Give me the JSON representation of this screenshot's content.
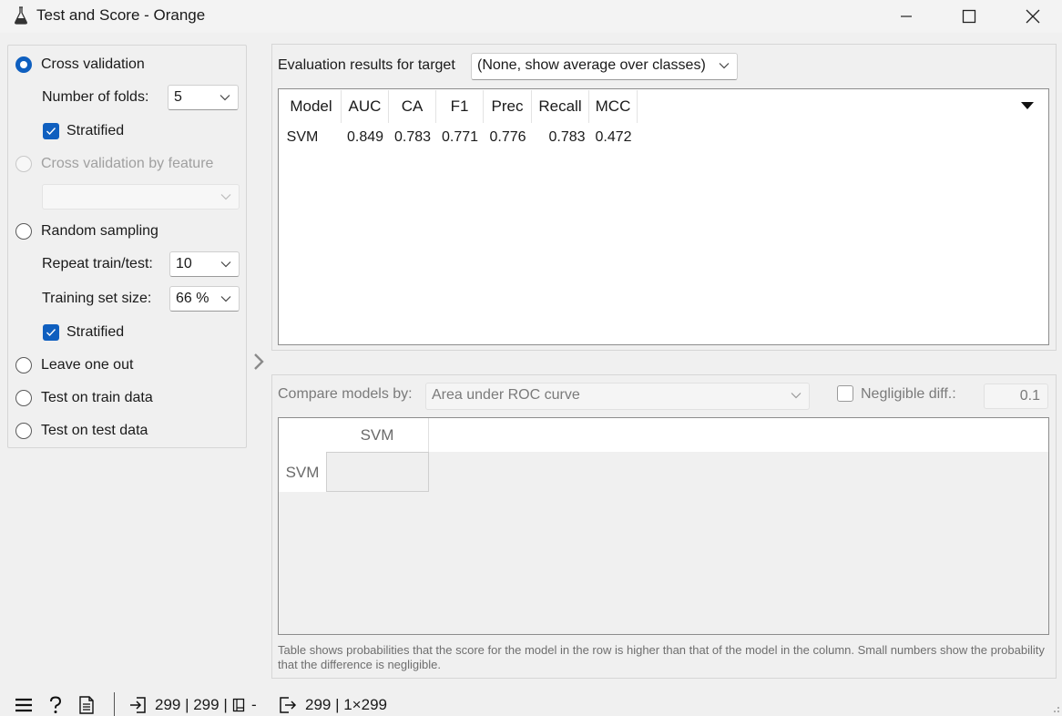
{
  "window": {
    "title": "Test and Score - Orange",
    "controls": [
      "minimize-icon",
      "maximize-icon",
      "close-icon"
    ]
  },
  "sampling": {
    "cross_validation": {
      "label": "Cross validation",
      "selected": true
    },
    "folds": {
      "label": "Number of folds:",
      "value": "5"
    },
    "stratified_cv": {
      "label": "Stratified",
      "checked": true
    },
    "cv_by_feature": {
      "label": "Cross validation by feature",
      "enabled": false,
      "value": ""
    },
    "random_sampling": {
      "label": "Random sampling",
      "selected": false
    },
    "repeat": {
      "label": "Repeat train/test:",
      "value": "10"
    },
    "train_size": {
      "label": "Training set size:",
      "value": "66 %"
    },
    "stratified_rs": {
      "label": "Stratified",
      "checked": true
    },
    "leave_one_out": {
      "label": "Leave one out",
      "selected": false
    },
    "test_on_train": {
      "label": "Test on train data",
      "selected": false
    },
    "test_on_test": {
      "label": "Test on test data",
      "selected": false
    }
  },
  "evaluation": {
    "label": "Evaluation results for target",
    "target": "(None, show average over classes)",
    "columns": [
      "Model",
      "AUC",
      "CA",
      "F1",
      "Prec",
      "Recall",
      "MCC"
    ],
    "rows": [
      [
        "SVM",
        "0.849",
        "0.783",
        "0.771",
        "0.776",
        "0.783",
        "0.472"
      ]
    ]
  },
  "comparison": {
    "label": "Compare models by:",
    "metric": "Area under ROC curve",
    "negligible": {
      "label": "Negligible diff.:",
      "checked": false,
      "value": "0.1"
    },
    "column_headers": [
      "SVM"
    ],
    "row_headers": [
      "SVM"
    ],
    "footnote": "Table shows probabilities that the score for the model in the row is higher than that of the model in the column. Small numbers show the probability that the difference is negligible."
  },
  "statusbar": {
    "input_summary": "299 | 299 |",
    "input_suffix": "-",
    "output_summary": "299 | 1×299"
  },
  "colors": {
    "accent": "#0f5fbf",
    "panel_bg": "#f0f0f0",
    "disabled_text": "#a0a0a0"
  }
}
